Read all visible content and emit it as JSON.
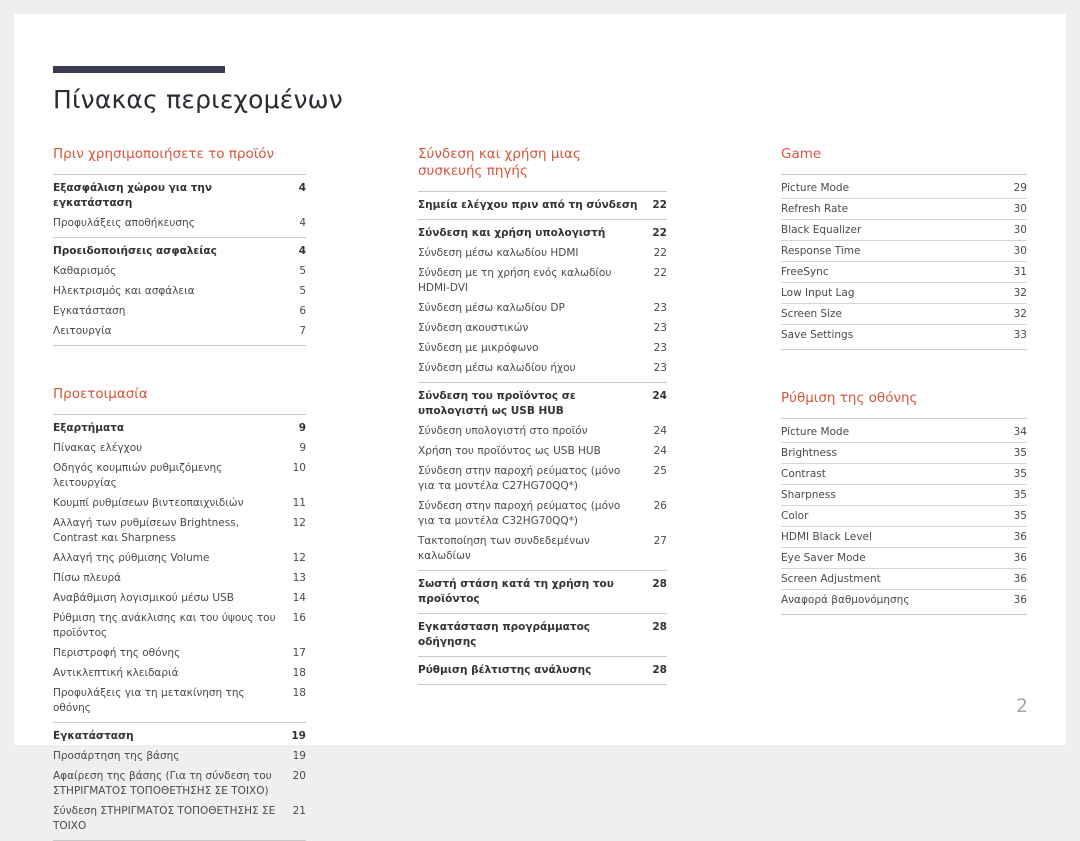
{
  "document": {
    "title": "Πίνακας περιεχομένων",
    "page_number": "2",
    "accent_color": "#d4563c",
    "rule_color": "#3b3b4f"
  },
  "columns": [
    {
      "sections": [
        {
          "heading": "Πριν χρησιμοποιήσετε το προϊόν",
          "groups": [
            {
              "entries": [
                {
                  "label": "Εξασφάλιση χώρου για την εγκατάσταση",
                  "page": "4",
                  "bold": true
                },
                {
                  "label": "Προφυλάξεις αποθήκευσης",
                  "page": "4",
                  "bold": false
                }
              ]
            },
            {
              "entries": [
                {
                  "label": "Προειδοποιήσεις ασφαλείας",
                  "page": "4",
                  "bold": true
                },
                {
                  "label": "Καθαρισμός",
                  "page": "5",
                  "bold": false
                },
                {
                  "label": "Ηλεκτρισμός και ασφάλεια",
                  "page": "5",
                  "bold": false
                },
                {
                  "label": "Εγκατάσταση",
                  "page": "6",
                  "bold": false
                },
                {
                  "label": "Λειτουργία",
                  "page": "7",
                  "bold": false
                }
              ]
            }
          ]
        },
        {
          "heading": "Προετοιμασία",
          "groups": [
            {
              "entries": [
                {
                  "label": "Εξαρτήματα",
                  "page": "9",
                  "bold": true
                },
                {
                  "label": "Πίνακας ελέγχου",
                  "page": "9",
                  "bold": false
                },
                {
                  "label": "Οδηγός κουμπιών ρυθμιζόμενης λειτουργίας",
                  "page": "10",
                  "bold": false
                },
                {
                  "label": "Κουμπί ρυθμίσεων βιντεοπαιχνιδιών",
                  "page": "11",
                  "bold": false
                },
                {
                  "label": "Αλλαγή των ρυθμίσεων Brightness, Contrast και Sharpness",
                  "page": "12",
                  "bold": false
                },
                {
                  "label": "Αλλαγή της ρύθμισης Volume",
                  "page": "12",
                  "bold": false
                },
                {
                  "label": "Πίσω πλευρά",
                  "page": "13",
                  "bold": false
                },
                {
                  "label": "Αναβάθμιση λογισμικού μέσω USB",
                  "page": "14",
                  "bold": false
                },
                {
                  "label": "Ρύθμιση της ανάκλισης και του ύψους του προϊόντος",
                  "page": "16",
                  "bold": false
                },
                {
                  "label": "Περιστροφή της οθόνης",
                  "page": "17",
                  "bold": false
                },
                {
                  "label": "Αντικλεπτική κλειδαριά",
                  "page": "18",
                  "bold": false
                },
                {
                  "label": "Προφυλάξεις για τη μετακίνηση της οθόνης",
                  "page": "18",
                  "bold": false
                }
              ]
            },
            {
              "entries": [
                {
                  "label": "Εγκατάσταση",
                  "page": "19",
                  "bold": true
                },
                {
                  "label": "Προσάρτηση της βάσης",
                  "page": "19",
                  "bold": false
                },
                {
                  "label": "Αφαίρεση της βάσης (Για τη σύνδεση του ΣΤΗΡΙΓΜΑΤΟΣ ΤΟΠΟΘΕΤΗΣΗΣ ΣΕ ΤΟΙΧΟ)",
                  "page": "20",
                  "bold": false
                },
                {
                  "label": "Σύνδεση ΣΤΗΡΙΓΜΑΤΟΣ ΤΟΠΟΘΕΤΗΣΗΣ ΣΕ ΤΟΙΧΟ",
                  "page": "21",
                  "bold": false,
                  "inline_page": true
                }
              ]
            }
          ]
        }
      ]
    },
    {
      "sections": [
        {
          "heading": "Σύνδεση και χρήση μιας\nσυσκευής πηγής",
          "groups": [
            {
              "entries": [
                {
                  "label": "Σημεία ελέγχου πριν από τη σύνδεση",
                  "page": "22",
                  "bold": true
                }
              ]
            },
            {
              "entries": [
                {
                  "label": "Σύνδεση και χρήση υπολογιστή",
                  "page": "22",
                  "bold": true
                },
                {
                  "label": "Σύνδεση μέσω καλωδίου HDMI",
                  "page": "22",
                  "bold": false
                },
                {
                  "label": "Σύνδεση με τη χρήση ενός καλωδίου HDMI-DVI",
                  "page": "22",
                  "bold": false
                },
                {
                  "label": "Σύνδεση μέσω καλωδίου DP",
                  "page": "23",
                  "bold": false
                },
                {
                  "label": "Σύνδεση ακουστικών",
                  "page": "23",
                  "bold": false
                },
                {
                  "label": "Σύνδεση με μικρόφωνο",
                  "page": "23",
                  "bold": false
                },
                {
                  "label": "Σύνδεση μέσω καλωδίου ήχου",
                  "page": "23",
                  "bold": false
                }
              ]
            },
            {
              "entries": [
                {
                  "label": "Σύνδεση του προϊόντος σε υπολογιστή ως USB HUB",
                  "page": "24",
                  "bold": true
                },
                {
                  "label": "Σύνδεση υπολογιστή στο προϊόν",
                  "page": "24",
                  "bold": false
                },
                {
                  "label": "Χρήση του προϊόντος ως USB HUB",
                  "page": "24",
                  "bold": false
                },
                {
                  "label": "Σύνδεση στην παροχή ρεύματος (μόνο για τα μοντέλα C27HG70QQ*)",
                  "page": "25",
                  "bold": false
                },
                {
                  "label": "Σύνδεση στην παροχή ρεύματος (μόνο για τα μοντέλα C32HG70QQ*)",
                  "page": "26",
                  "bold": false
                },
                {
                  "label": "Τακτοποίηση των συνδεδεμένων καλωδίων",
                  "page": "27",
                  "bold": false
                }
              ]
            },
            {
              "entries": [
                {
                  "label": "Σωστή στάση κατά τη χρήση του προϊόντος",
                  "page": "28",
                  "bold": true
                }
              ]
            },
            {
              "entries": [
                {
                  "label": "Εγκατάσταση προγράμματος οδήγησης",
                  "page": "28",
                  "bold": true
                }
              ]
            },
            {
              "entries": [
                {
                  "label": "Ρύθμιση βέλτιστης ανάλυσης",
                  "page": "28",
                  "bold": true
                }
              ]
            }
          ]
        }
      ]
    },
    {
      "sections": [
        {
          "heading": "Game",
          "ruled_rows": true,
          "groups": [
            {
              "entries": [
                {
                  "label": "Picture Mode",
                  "page": "29",
                  "bold": false
                },
                {
                  "label": "Refresh Rate",
                  "page": "30",
                  "bold": false
                },
                {
                  "label": "Black Equalizer",
                  "page": "30",
                  "bold": false
                },
                {
                  "label": "Response Time",
                  "page": "30",
                  "bold": false
                },
                {
                  "label": "FreeSync",
                  "page": "31",
                  "bold": false
                },
                {
                  "label": "Low Input Lag",
                  "page": "32",
                  "bold": false
                },
                {
                  "label": "Screen Size",
                  "page": "32",
                  "bold": false
                },
                {
                  "label": "Save Settings",
                  "page": "33",
                  "bold": false
                }
              ]
            }
          ]
        },
        {
          "heading": "Ρύθμιση της οθόνης",
          "ruled_rows": true,
          "groups": [
            {
              "entries": [
                {
                  "label": "Picture Mode",
                  "page": "34",
                  "bold": false
                },
                {
                  "label": "Brightness",
                  "page": "35",
                  "bold": false
                },
                {
                  "label": "Contrast",
                  "page": "35",
                  "bold": false
                },
                {
                  "label": "Sharpness",
                  "page": "35",
                  "bold": false
                },
                {
                  "label": "Color",
                  "page": "35",
                  "bold": false
                },
                {
                  "label": "HDMI Black Level",
                  "page": "36",
                  "bold": false
                },
                {
                  "label": "Eye Saver Mode",
                  "page": "36",
                  "bold": false
                },
                {
                  "label": "Screen Adjustment",
                  "page": "36",
                  "bold": false
                },
                {
                  "label": "Αναφορά βαθμονόμησης",
                  "page": "36",
                  "bold": false
                }
              ]
            }
          ]
        }
      ]
    }
  ]
}
